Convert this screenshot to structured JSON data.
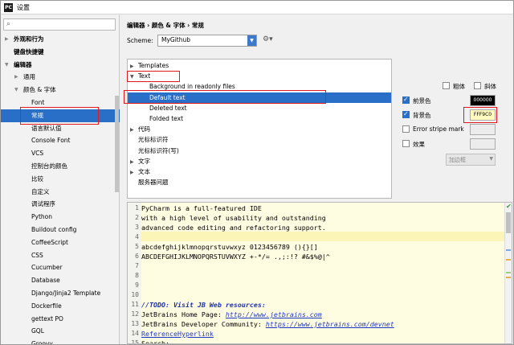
{
  "window": {
    "title": "设置"
  },
  "search": {
    "placeholder": ""
  },
  "tree": [
    {
      "label": "外观和行为",
      "arrow": "▶",
      "indent": 0,
      "bold": true,
      "selected": false
    },
    {
      "label": "键盘快捷键",
      "arrow": "",
      "indent": 0,
      "bold": true,
      "selected": false
    },
    {
      "label": "编辑器",
      "arrow": "▼",
      "indent": 0,
      "bold": true,
      "selected": false
    },
    {
      "label": "通用",
      "arrow": "▶",
      "indent": 1,
      "bold": false,
      "selected": false
    },
    {
      "label": "颜色 & 字体",
      "arrow": "▼",
      "indent": 1,
      "bold": false,
      "selected": false
    },
    {
      "label": "Font",
      "arrow": "",
      "indent": 2,
      "bold": false,
      "selected": false
    },
    {
      "label": "常规",
      "arrow": "",
      "indent": 2,
      "bold": false,
      "selected": true
    },
    {
      "label": "语言默认值",
      "arrow": "",
      "indent": 2,
      "bold": false,
      "selected": false
    },
    {
      "label": "Console Font",
      "arrow": "",
      "indent": 2,
      "bold": false,
      "selected": false
    },
    {
      "label": "VCS",
      "arrow": "",
      "indent": 2,
      "bold": false,
      "selected": false
    },
    {
      "label": "控制台的颜色",
      "arrow": "",
      "indent": 2,
      "bold": false,
      "selected": false
    },
    {
      "label": "比较",
      "arrow": "",
      "indent": 2,
      "bold": false,
      "selected": false
    },
    {
      "label": "自定义",
      "arrow": "",
      "indent": 2,
      "bold": false,
      "selected": false
    },
    {
      "label": "调试程序",
      "arrow": "",
      "indent": 2,
      "bold": false,
      "selected": false
    },
    {
      "label": "Python",
      "arrow": "",
      "indent": 2,
      "bold": false,
      "selected": false
    },
    {
      "label": "Buildout config",
      "arrow": "",
      "indent": 2,
      "bold": false,
      "selected": false
    },
    {
      "label": "CoffeeScript",
      "arrow": "",
      "indent": 2,
      "bold": false,
      "selected": false
    },
    {
      "label": "CSS",
      "arrow": "",
      "indent": 2,
      "bold": false,
      "selected": false
    },
    {
      "label": "Cucumber",
      "arrow": "",
      "indent": 2,
      "bold": false,
      "selected": false
    },
    {
      "label": "Database",
      "arrow": "",
      "indent": 2,
      "bold": false,
      "selected": false
    },
    {
      "label": "Django/Jinja2 Template",
      "arrow": "",
      "indent": 2,
      "bold": false,
      "selected": false
    },
    {
      "label": "Dockerfile",
      "arrow": "",
      "indent": 2,
      "bold": false,
      "selected": false
    },
    {
      "label": "gettext PO",
      "arrow": "",
      "indent": 2,
      "bold": false,
      "selected": false
    },
    {
      "label": "GQL",
      "arrow": "",
      "indent": 2,
      "bold": false,
      "selected": false
    },
    {
      "label": "Groovy",
      "arrow": "",
      "indent": 2,
      "bold": false,
      "selected": false
    }
  ],
  "breadcrumb": "编辑器 › 颜色 & 字体 › 常规",
  "scheme": {
    "label": "Scheme:",
    "value": "MyGithub"
  },
  "categories": [
    {
      "label": "Templates",
      "arrow": "▶",
      "indent": 0
    },
    {
      "label": "Text",
      "arrow": "▼",
      "indent": 0
    },
    {
      "label": "Background in readonly files",
      "arrow": "",
      "indent": 1
    },
    {
      "label": "Default text",
      "arrow": "",
      "indent": 1
    },
    {
      "label": "Deleted text",
      "arrow": "",
      "indent": 1
    },
    {
      "label": "Folded text",
      "arrow": "",
      "indent": 1
    },
    {
      "label": "代码",
      "arrow": "▶",
      "indent": 0
    },
    {
      "label": "光标标识符",
      "arrow": "",
      "indent": 0
    },
    {
      "label": "光标标识符(写)",
      "arrow": "",
      "indent": 0
    },
    {
      "label": "文字",
      "arrow": "▶",
      "indent": 0
    },
    {
      "label": "文本",
      "arrow": "▶",
      "indent": 0
    },
    {
      "label": "服务器问题",
      "arrow": "",
      "indent": 0
    }
  ],
  "options": {
    "bold": "粗体",
    "italic": "斜体",
    "foreground": "前景色",
    "foreground_color": "000000",
    "foreground_checked": true,
    "background": "背景色",
    "background_color": "FFF9C0",
    "background_checked": true,
    "error_stripe": "Error stripe mark",
    "error_checked": false,
    "effects": "效果",
    "effects_checked": false,
    "effect_type": "加边框"
  },
  "editor": {
    "lines": [
      {
        "n": "1",
        "t": "PyCharm is a full-featured IDE"
      },
      {
        "n": "2",
        "t": "with a high level of usability and outstanding"
      },
      {
        "n": "3",
        "t": "advanced code editing and refactoring support."
      },
      {
        "n": "4",
        "t": ""
      },
      {
        "n": "5",
        "t": "abcdefghijklmnopqrstuvwxyz 0123456789 (){}[]"
      },
      {
        "n": "6",
        "t": "ABCDEFGHIJKLMNOPQRSTUVWXYZ +-*/= .,;:!? #&$%@|^"
      },
      {
        "n": "7",
        "t": ""
      },
      {
        "n": "8",
        "t": ""
      },
      {
        "n": "9",
        "t": ""
      },
      {
        "n": "10",
        "t": ""
      },
      {
        "n": "11",
        "t": "//TODO: Visit JB Web resources:"
      },
      {
        "n": "12",
        "t": "JetBrains Home Page: ",
        "link": "http://www.jetbrains.com"
      },
      {
        "n": "13",
        "t": "JetBrains Developer Community: ",
        "link2": "https://www.jetbrains.com/devnet"
      },
      {
        "n": "14",
        "t": "",
        "link3": "ReferenceHyperlink"
      },
      {
        "n": "15",
        "t": "Search:"
      }
    ]
  }
}
